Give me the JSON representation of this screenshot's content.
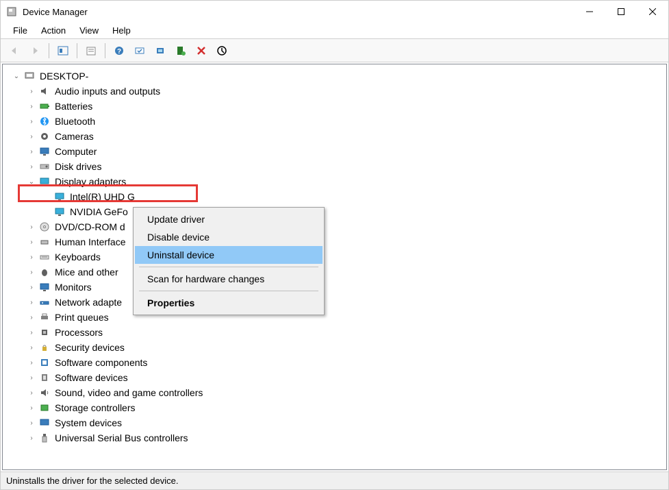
{
  "window": {
    "title": "Device Manager"
  },
  "menu": {
    "file": "File",
    "action": "Action",
    "view": "View",
    "help": "Help"
  },
  "tree": {
    "root": "DESKTOP-",
    "audio": "Audio inputs and outputs",
    "batteries": "Batteries",
    "bluetooth": "Bluetooth",
    "cameras": "Cameras",
    "computer": "Computer",
    "disk": "Disk drives",
    "display": "Display adapters",
    "intel": "Intel(R) UHD G",
    "nvidia": "NVIDIA GeFo",
    "dvd": "DVD/CD-ROM d",
    "hid": "Human Interface",
    "keyboards": "Keyboards",
    "mice": "Mice and other",
    "monitors": "Monitors",
    "network": "Network adapte",
    "printq": "Print queues",
    "processors": "Processors",
    "security": "Security devices",
    "swcomponents": "Software components",
    "swdevices": "Software devices",
    "sound": "Sound, video and game controllers",
    "storage": "Storage controllers",
    "system": "System devices",
    "usb": "Universal Serial Bus controllers"
  },
  "context_menu": {
    "update": "Update driver",
    "disable": "Disable device",
    "uninstall": "Uninstall device",
    "scan": "Scan for hardware changes",
    "properties": "Properties"
  },
  "statusbar": {
    "text": "Uninstalls the driver for the selected device."
  }
}
